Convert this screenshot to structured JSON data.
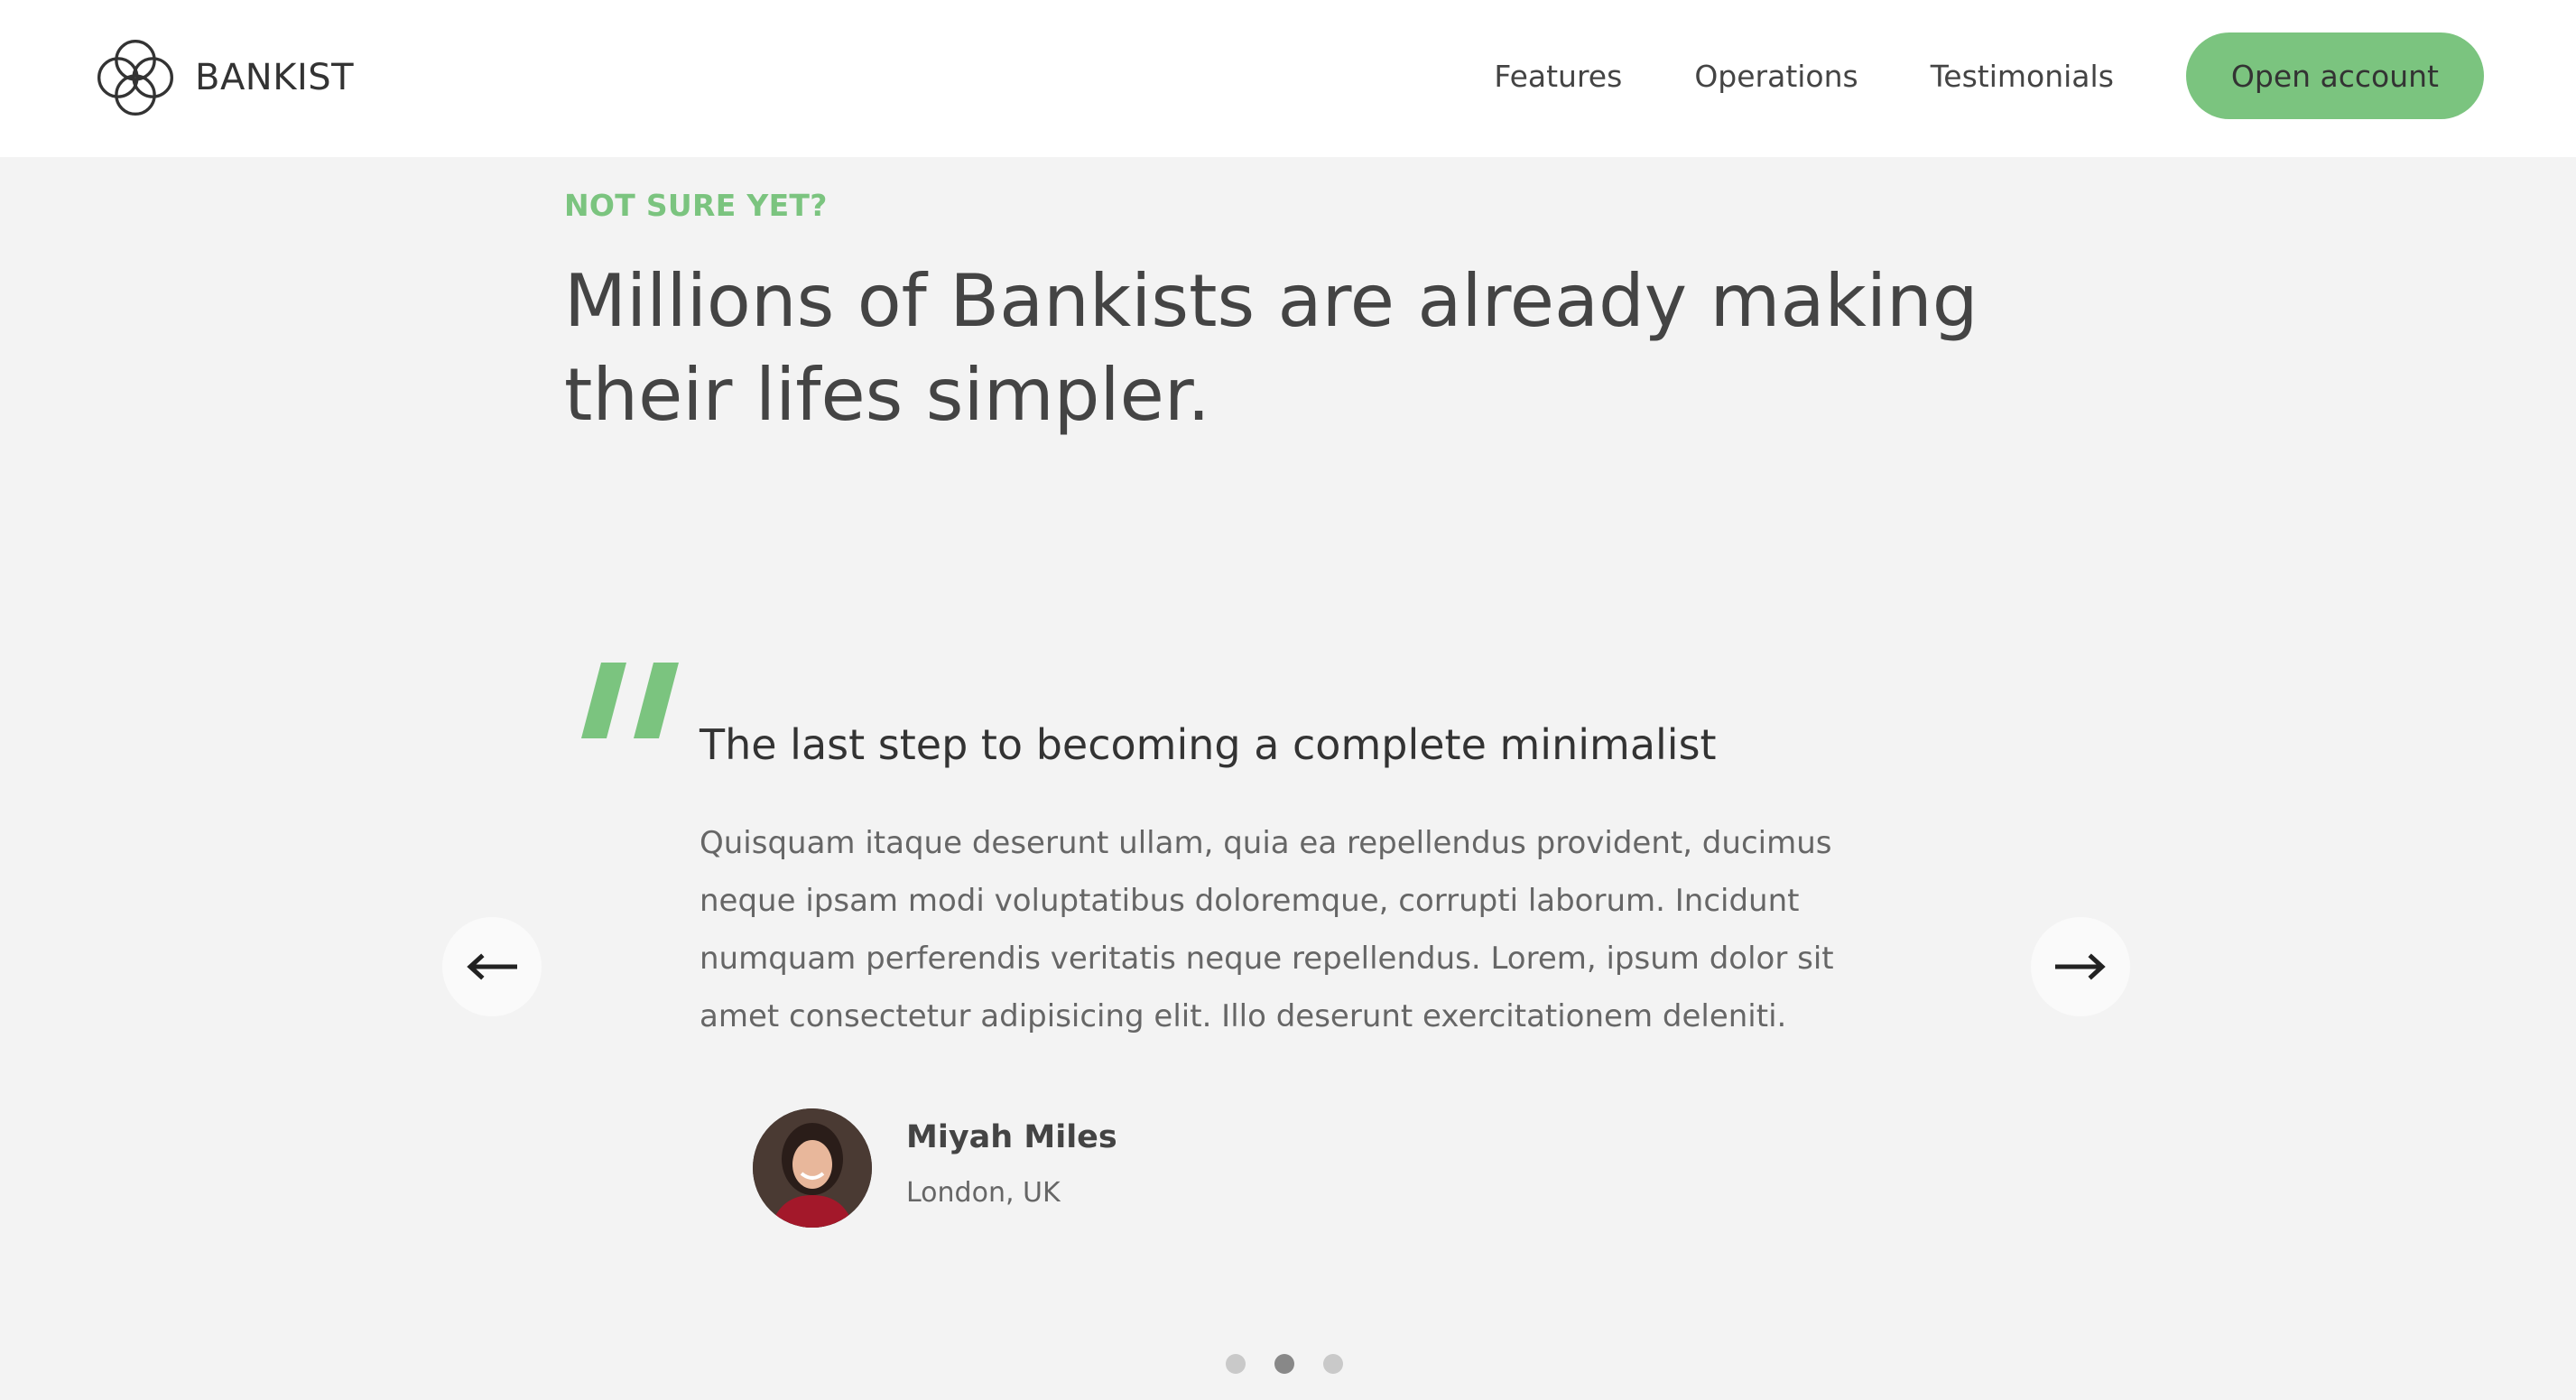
{
  "nav": {
    "brand": "BANKIST",
    "links": [
      "Features",
      "Operations",
      "Testimonials"
    ],
    "cta": "Open account"
  },
  "section": {
    "label": "NOT SURE YET?",
    "headline_line1": "Millions of Bankists are already making",
    "headline_line2": "their lifes simpler."
  },
  "testimonial": {
    "title": "The last step to becoming a complete minimalist",
    "text": "Quisquam itaque deserunt ullam, quia ea repellendus provident, ducimus neque ipsam modi voluptatibus doloremque, corrupti laborum. Incidunt numquam perferendis veritatis neque repellendus. Lorem, ipsum dolor sit amet consectetur adipisicing elit. Illo deserunt exercitationem deleniti.",
    "author_name": "Miyah Miles",
    "author_location": "London, UK"
  },
  "slider": {
    "slide_count": 3,
    "active_index": 1
  },
  "colors": {
    "accent": "#7bc47f",
    "background": "#f3f3f3",
    "text": "#444444"
  },
  "icons": [
    "bankist-logo-icon",
    "quote-icon",
    "arrow-left-icon",
    "arrow-right-icon"
  ]
}
